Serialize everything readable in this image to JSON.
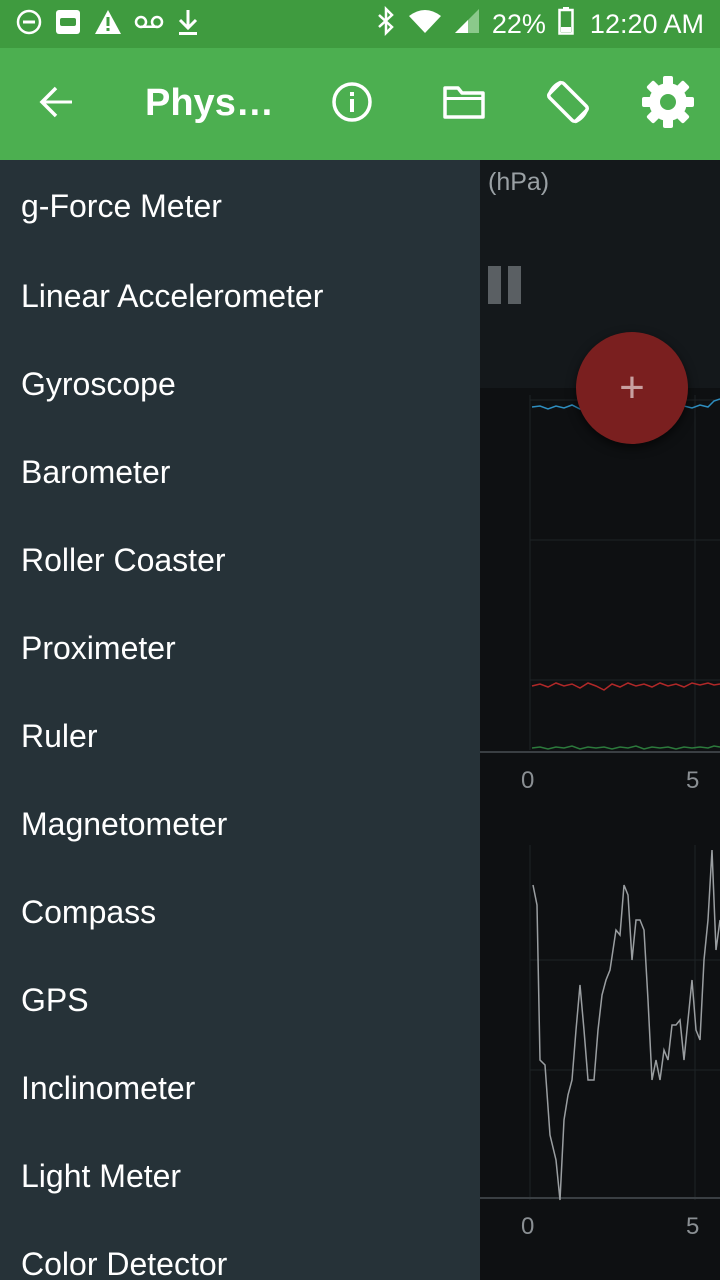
{
  "status_bar": {
    "battery": "22%",
    "time": "12:20 AM",
    "icons": [
      "do-not-disturb-icon",
      "screen-icon",
      "warning-icon",
      "voicemail-icon",
      "download-icon",
      "bluetooth-icon",
      "wifi-icon",
      "signal-icon",
      "battery-icon"
    ]
  },
  "app_bar": {
    "title": "Physi…",
    "background": "#4caf50",
    "icons": [
      "back-arrow-icon",
      "info-icon",
      "folder-icon",
      "screen-rotation-icon",
      "gear-icon"
    ]
  },
  "drawer": {
    "background": "#263238",
    "items": [
      "g-Force Meter",
      "Linear Accelerometer",
      "Gyroscope",
      "Barometer",
      "Roller Coaster",
      "Proximeter",
      "Ruler",
      "Magnetometer",
      "Compass",
      "GPS",
      "Inclinometer",
      "Light Meter",
      "Color Detector"
    ]
  },
  "background_screen": {
    "unit_label": "(hPa)",
    "fab_label": "+",
    "fab_color": "#7a1f1f",
    "chart1_ticks": [
      "0",
      "5"
    ],
    "chart2_ticks": [
      "0",
      "5"
    ]
  }
}
